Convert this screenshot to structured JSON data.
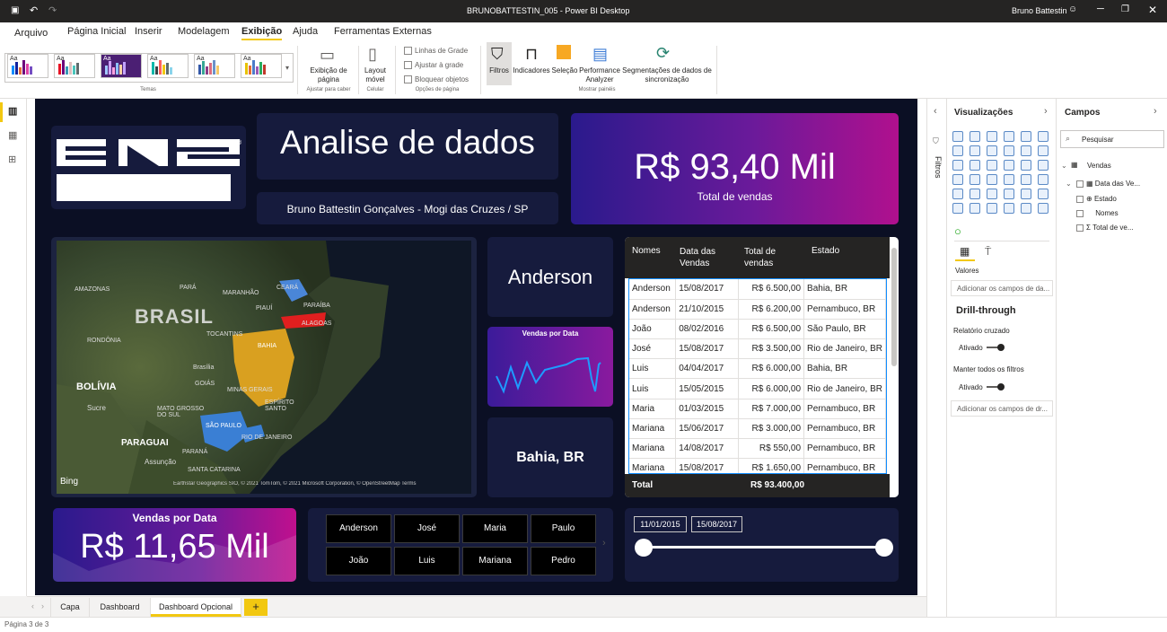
{
  "window": {
    "title": "BRUNOBATTESTIN_005 - Power BI Desktop",
    "user": "Bruno Battestin"
  },
  "ribbon_tabs": [
    "Arquivo",
    "Página Inicial",
    "Inserir",
    "Modelagem",
    "Exibição",
    "Ajuda",
    "Ferramentas Externas"
  ],
  "ribbon": {
    "themes_group": "Temas",
    "page_view": "Exibição de página",
    "page_view_sub": "Ajustar para caber",
    "mobile_layout": "Layout móvel",
    "mobile_group": "Celular",
    "gridlines": "Linhas de Grade",
    "snap_grid": "Ajustar à grade",
    "lock_objects": "Bloquear objetos",
    "page_options_group": "Opções de página",
    "filters": "Filtros",
    "bookmarks": "Indicadores",
    "selection": "Seleção",
    "performance": "Performance Analyzer",
    "sync_slicers": "Segmentações de dados de sincronização",
    "show_panes_group": "Mostrar painéis"
  },
  "report": {
    "logo_text": "ENS",
    "title": "Analise de dados",
    "subtitle": "Bruno Battestin Gonçalves - Mogi das Cruzes / SP",
    "kpi_total": "R$ 93,40 Mil",
    "kpi_total_label": "Total de vendas",
    "name_card": "Anderson",
    "sparkline_title": "Vendas por Data",
    "state_card": "Bahia, BR",
    "bottom_kpi_title": "Vendas por Data",
    "bottom_kpi_value": "R$ 11,65 Mil",
    "map_labels": {
      "country": "BRASIL",
      "bolivia": "BOLÍVIA",
      "paraguai": "PARAGUAI",
      "bing": "Bing",
      "copyright": "Earthstar Geographics SIO, © 2021 TomTom, © 2021 Microsoft Corporation, © OpenStreetMap  Terms",
      "places": [
        "AMAZONAS",
        "PARÁ",
        "MARANHÃO",
        "CEARÁ",
        "PIAUÍ",
        "PARAÍBA",
        "ALAGOAS",
        "RONDÔNIA",
        "BAHIA",
        "TOCANTINS",
        "Brasília",
        "GOIÁS",
        "MINAS GERAIS",
        "ESPÍRITO SANTO",
        "MATO GROSSO DO SUL",
        "SÃO PAULO",
        "RIO DE JANEIRO",
        "Sucre",
        "Assunção",
        "SANTA CATARINA",
        "PARANÁ"
      ]
    },
    "table": {
      "headers": [
        "Nomes",
        "Data das Vendas",
        "Total de vendas",
        "Estado"
      ],
      "rows": [
        [
          "Anderson",
          "15/08/2017",
          "R$ 6.500,00",
          "Bahia, BR"
        ],
        [
          "Anderson",
          "21/10/2015",
          "R$ 6.200,00",
          "Pernambuco, BR"
        ],
        [
          "João",
          "08/02/2016",
          "R$ 6.500,00",
          "São Paulo, BR"
        ],
        [
          "José",
          "15/08/2017",
          "R$ 3.500,00",
          "Rio de Janeiro, BR"
        ],
        [
          "Luis",
          "04/04/2017",
          "R$ 6.000,00",
          "Bahia, BR"
        ],
        [
          "Luis",
          "15/05/2015",
          "R$ 6.000,00",
          "Rio de Janeiro, BR"
        ],
        [
          "Maria",
          "01/03/2015",
          "R$ 7.000,00",
          "Pernambuco, BR"
        ],
        [
          "Mariana",
          "15/06/2017",
          "R$ 3.000,00",
          "Pernambuco, BR"
        ],
        [
          "Mariana",
          "14/08/2017",
          "R$ 550,00",
          "Pernambuco, BR"
        ],
        [
          "Mariana",
          "15/08/2017",
          "R$ 1.650,00",
          "Pernambuco, BR"
        ]
      ],
      "total_label": "Total",
      "total_value": "R$ 93.400,00"
    },
    "slicer_names": [
      "Anderson",
      "José",
      "Maria",
      "Paulo",
      "João",
      "Luis",
      "Mariana",
      "Pedro"
    ],
    "date_slicer": {
      "start": "11/01/2015",
      "end": "15/08/2017"
    }
  },
  "panes": {
    "filters": "Filtros",
    "viz_title": "Visualizações",
    "values_label": "Valores",
    "values_placeholder": "Adicionar os campos de da...",
    "drillthrough": "Drill-through",
    "cross_report": "Relatório cruzado",
    "cross_report_state": "Ativado",
    "keep_filters": "Manter todos os filtros",
    "keep_filters_state": "Ativado",
    "drill_placeholder": "Adicionar os campos de dr...",
    "fields_title": "Campos",
    "search_placeholder": "Pesquisar",
    "table_name": "Vendas",
    "fields": [
      "Data das Ve...",
      "Estado",
      "Nomes",
      "Total de ve..."
    ]
  },
  "page_tabs": [
    "Capa",
    "Dashboard",
    "Dashboard Opcional"
  ],
  "status": "Página 3 de 3"
}
